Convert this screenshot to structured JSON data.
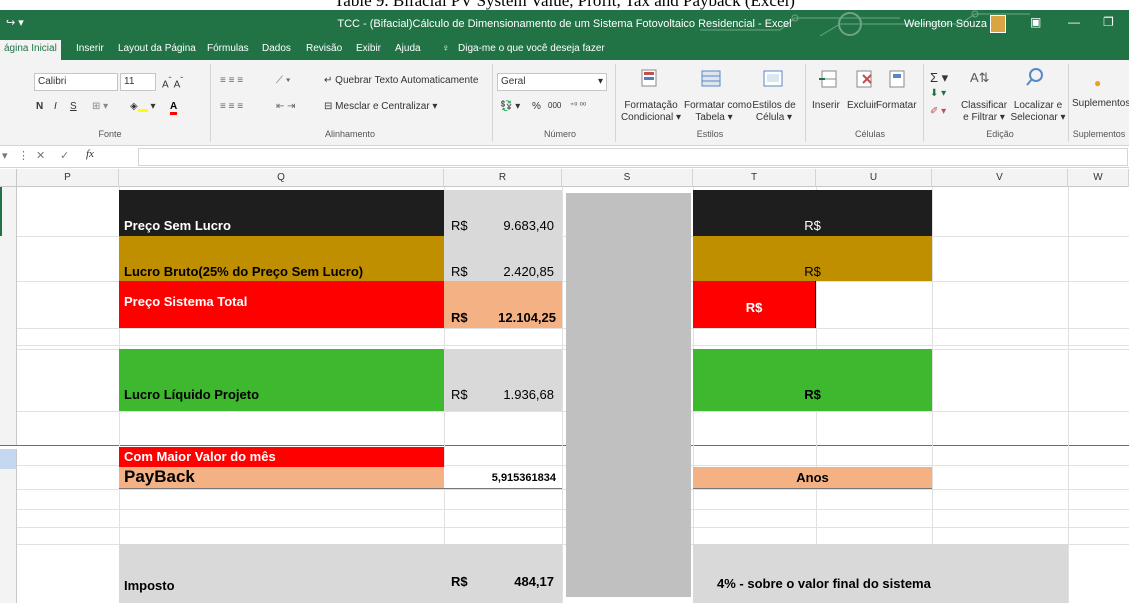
{
  "caption": "Table 9. Bifacial PV System Value, Profit, Tax and Payback (Excel)",
  "window": {
    "title": "TCC - (Bifacial)Cálculo de Dimensionamento de um Sistema Fotovoltaico Residencial  -  Excel",
    "user": "Welington Souza",
    "qat_icons": [
      "redo-icon",
      "customize-qat-icon"
    ]
  },
  "tabs": [
    {
      "label": "ágina Inicial",
      "active": true
    },
    {
      "label": "Inserir"
    },
    {
      "label": "Layout da Página"
    },
    {
      "label": "Fórmulas"
    },
    {
      "label": "Dados"
    },
    {
      "label": "Revisão"
    },
    {
      "label": "Exibir"
    },
    {
      "label": "Ajuda"
    }
  ],
  "tell_me": "Diga-me o que você deseja fazer",
  "ribbon": {
    "font": {
      "name": "Calibri",
      "size": "11",
      "label": "Fonte",
      "bold": "N",
      "italic": "I",
      "underline": "S"
    },
    "alignment": {
      "wrap": "Quebrar Texto Automaticamente",
      "merge": "Mesclar e Centralizar",
      "label": "Alinhamento"
    },
    "number": {
      "format": "Geral",
      "percent": "%",
      "thousands": "000",
      "label": "Número"
    },
    "styles": {
      "conditional": [
        "Formatação",
        "Condicional"
      ],
      "table": [
        "Formatar como",
        "Tabela"
      ],
      "cell": [
        "Estilos de",
        "Célula"
      ],
      "label": "Estilos"
    },
    "cells": {
      "insert": "Inserir",
      "delete": "Excluir",
      "format": "Formatar",
      "label": "Células"
    },
    "editing": {
      "sort": [
        "Classificar",
        "e Filtrar"
      ],
      "find": [
        "Localizar e",
        "Selecionar"
      ],
      "label": "Edição"
    },
    "addins": {
      "name": "Suplementos",
      "label": "Suplementos"
    }
  },
  "formula_bar": {
    "fx": "fx",
    "value": ""
  },
  "columns": [
    "P",
    "Q",
    "R",
    "S",
    "T",
    "U",
    "V",
    "W"
  ],
  "colors": {
    "black": "#1e1e1e",
    "gold": "#bf8f00",
    "red": "#ff0000",
    "salmon": "#f4b183",
    "green": "#3db82f",
    "lightgray": "#d9d9d9",
    "midgray": "#c0c0c0",
    "excel_green": "#217346"
  },
  "cells": {
    "preco_sem_lucro": {
      "label": "Preço Sem Lucro",
      "currency": "R$",
      "value": "9.683,40",
      "t": "R$"
    },
    "lucro_bruto": {
      "label": "Lucro Bruto(25% do Preço Sem Lucro)",
      "currency": "R$",
      "value": "2.420,85",
      "t": "R$"
    },
    "preco_total": {
      "label": "Preço Sistema Total",
      "currency": "R$",
      "value": "12.104,25",
      "t": "R$"
    },
    "lucro_liquido": {
      "label": "Lucro Líquido Projeto",
      "currency": "R$",
      "value": "1.936,68",
      "t": "R$"
    },
    "maior_valor": {
      "label": "Com Maior Valor do mês"
    },
    "payback": {
      "label": "PayBack",
      "value": "5,915361834",
      "t": "Anos"
    },
    "imposto": {
      "label": "Imposto",
      "currency": "R$",
      "value": "484,17",
      "t": "4% -  sobre o valor final do sistema"
    }
  }
}
